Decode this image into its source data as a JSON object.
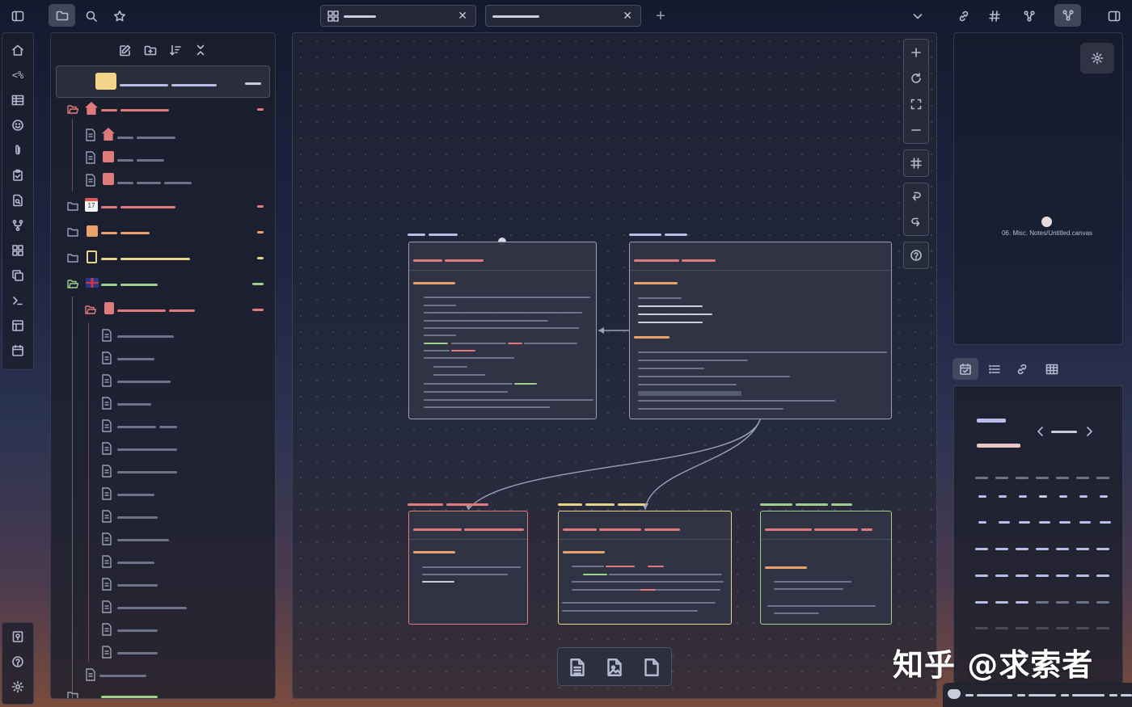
{
  "graph_view": {
    "node_label": "06. Misc. Notes/Untitled.canvas"
  },
  "watermark": {
    "text": "知乎 @求索者"
  },
  "icons": {
    "left_ribbon": [
      "home-icon",
      "templater-icon",
      "table-icon",
      "smiley-icon",
      "paperclip-icon",
      "clipboard-check-icon",
      "file-search-icon",
      "git-fork-icon",
      "dashboard-icon",
      "copy-icon",
      "terminal-icon",
      "layout-icon",
      "calendar-icon",
      "vault-icon",
      "help-icon",
      "settings-icon"
    ],
    "top_right": [
      "link-icon",
      "hashtag-icon",
      "graph-pin-icon",
      "graph-icon",
      "right-sidebar-toggle-icon"
    ],
    "canvas_controls": [
      "zoom-in-icon",
      "reset-icon",
      "fit-icon",
      "zoom-out-icon",
      "grid-icon",
      "undo-icon",
      "redo-icon",
      "help-icon"
    ],
    "canvas_bottom": [
      "new-note-icon",
      "media-icon",
      "blank-card-icon"
    ]
  },
  "colors": {
    "accent_red": "#e07b7b",
    "accent_orange": "#eba16b",
    "accent_yellow": "#e6d48a",
    "accent_green": "#9fcf8c",
    "lavender": "#b7bde6",
    "folder_yellow": "#f3d58a"
  }
}
